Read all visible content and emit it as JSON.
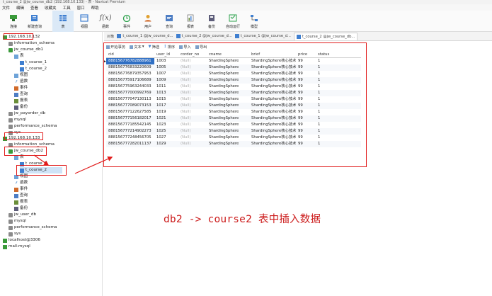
{
  "window": {
    "title": "t_course_2 @jw_course_db2 (192.168.10.133) - 表 - Navicat Premium"
  },
  "menu": [
    "文件",
    "编辑",
    "查看",
    "收藏夹",
    "工具",
    "窗口",
    "帮助"
  ],
  "toolbar": [
    {
      "label": "连接",
      "icon": "connection-icon"
    },
    {
      "label": "新建查询",
      "icon": "new-query-icon"
    },
    {
      "label": "表",
      "icon": "table-icon",
      "active": true
    },
    {
      "label": "视图",
      "icon": "view-icon"
    },
    {
      "label": "函数",
      "icon": "function-icon"
    },
    {
      "label": "事件",
      "icon": "event-icon"
    },
    {
      "label": "用户",
      "icon": "user-icon"
    },
    {
      "label": "查询",
      "icon": "query-icon"
    },
    {
      "label": "报表",
      "icon": "report-icon"
    },
    {
      "label": "备份",
      "icon": "backup-icon"
    },
    {
      "label": "自动运行",
      "icon": "autorun-icon"
    },
    {
      "label": "模型",
      "icon": "model-icon"
    }
  ],
  "tree": {
    "conn1": "192.168.10.132",
    "conn1_info_schema": "information_schema",
    "conn1_db1": "jw_course_db1",
    "conn1_tables": "表",
    "conn1_t1": "t_course_1",
    "conn1_t2": "t_course_2",
    "conn1_views": "视图",
    "conn1_funcs": "函数",
    "conn1_events": "事件",
    "conn1_queries": "查询",
    "conn1_reports": "报表",
    "conn1_backups": "备份",
    "conn1_payorder": "jw_payorder_db",
    "conn1_mysql": "mysql",
    "conn1_perf": "performance_schema",
    "conn1_sys": "sys",
    "conn2": "192.168.10.133",
    "conn2_info_schema": "information_schema",
    "conn2_db2": "jw_course_db2",
    "conn2_tables": "表",
    "conn2_t1": "t_course_1",
    "conn2_t2": "t_course_2",
    "conn2_views": "视图",
    "conn2_funcs": "函数",
    "conn2_events": "事件",
    "conn2_queries": "查询",
    "conn2_reports": "报表",
    "conn2_backups": "备份",
    "conn2_user_db": "jw_user_db",
    "conn2_mysql": "mysql",
    "conn2_perf": "performance_schema",
    "conn2_sys": "sys",
    "conn3": "localhost@3306",
    "conn4": "mall-mysql"
  },
  "tabs": {
    "objects": "对象",
    "tab1": "t_course_1 @jw_course_d...",
    "tab2": "t_course_2 @jw_course_d...",
    "tab3": "t_course_1 @jw_course_d...",
    "tab4": "t_course_2 @jw_course_db..."
  },
  "gridtools": {
    "begin_tx": "开始事务",
    "text": "文本",
    "filter": "筛选",
    "sort": "排序",
    "import": "导入",
    "export": "导出"
  },
  "grid": {
    "columns": [
      "cid",
      "user_id",
      "corder_no",
      "cname",
      "brief",
      "price",
      "status"
    ],
    "null_text": "(Null)",
    "rows": [
      [
        "888156776782888961",
        "1003",
        "(Null)",
        "ShardingSphere",
        "ShardingSphere核心技术",
        "99",
        "1"
      ],
      [
        "888156776833220609",
        "1005",
        "(Null)",
        "ShardingSphere",
        "ShardingSphere核心技术",
        "99",
        "1"
      ],
      [
        "888156776879357953",
        "1007",
        "(Null)",
        "ShardingSphere",
        "ShardingSphere核心技术",
        "99",
        "1"
      ],
      [
        "888156775917106689",
        "1009",
        "(Null)",
        "ShardingSphere",
        "ShardingSphere核心技术",
        "99",
        "1"
      ],
      [
        "888156775963244033",
        "1011",
        "(Null)",
        "ShardingSphere",
        "ShardingSphere核心技术",
        "99",
        "1"
      ],
      [
        "888156777000992769",
        "1013",
        "(Null)",
        "ShardingSphere",
        "ShardingSphere核心技术",
        "99",
        "1"
      ],
      [
        "888156777047130113",
        "1015",
        "(Null)",
        "ShardingSphere",
        "ShardingSphere核心技术",
        "99",
        "1"
      ],
      [
        "888156777089073153",
        "1017",
        "(Null)",
        "ShardingSphere",
        "ShardingSphere核心技术",
        "99",
        "1"
      ],
      [
        "888156777122627585",
        "1019",
        "(Null)",
        "ShardingSphere",
        "ShardingSphere核心技术",
        "99",
        "1"
      ],
      [
        "888156777156182017",
        "1021",
        "(Null)",
        "ShardingSphere",
        "ShardingSphere核心技术",
        "99",
        "1"
      ],
      [
        "888156777185542145",
        "1023",
        "(Null)",
        "ShardingSphere",
        "ShardingSphere核心技术",
        "99",
        "1"
      ],
      [
        "888156777214902273",
        "1025",
        "(Null)",
        "ShardingSphere",
        "ShardingSphere核心技术",
        "99",
        "1"
      ],
      [
        "888156777248456705",
        "1027",
        "(Null)",
        "ShardingSphere",
        "ShardingSphere核心技术",
        "99",
        "1"
      ],
      [
        "888156777282011137",
        "1029",
        "(Null)",
        "ShardingSphere",
        "ShardingSphere核心技术",
        "99",
        "1"
      ]
    ]
  },
  "annotation": "db2 -> course2 表中插入数据",
  "colors": {
    "highlight_red": "#e11b1b",
    "selection_blue": "#2f6fc4",
    "annotation_red": "#cc1c1c"
  }
}
